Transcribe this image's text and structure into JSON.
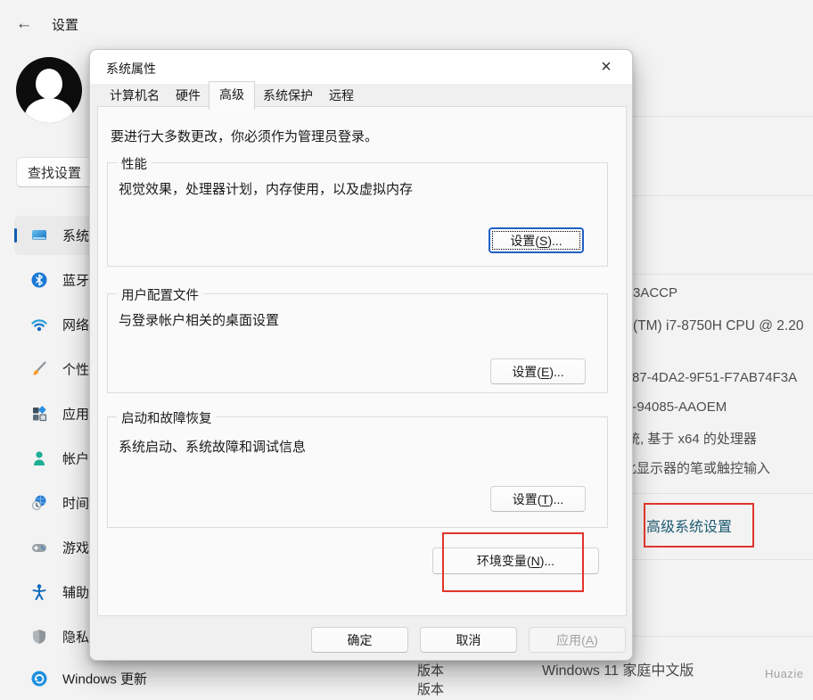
{
  "page": {
    "title": "设置",
    "back_icon": "←",
    "watermark": "Huazie"
  },
  "search": {
    "placeholder": "查找设置"
  },
  "sidebar": {
    "items": [
      {
        "label": "系统",
        "icon": "system-icon",
        "selected": true
      },
      {
        "label": "蓝牙和其他设备",
        "icon": "bluetooth-icon",
        "selected": false
      },
      {
        "label": "网络和 Internet",
        "icon": "network-icon",
        "selected": false
      },
      {
        "label": "个性化",
        "icon": "personalization-icon",
        "selected": false
      },
      {
        "label": "应用",
        "icon": "apps-icon",
        "selected": false
      },
      {
        "label": "帐户",
        "icon": "accounts-icon",
        "selected": false
      },
      {
        "label": "时间和语言",
        "icon": "time-language-icon",
        "selected": false
      },
      {
        "label": "游戏",
        "icon": "gaming-icon",
        "selected": false
      },
      {
        "label": "辅助功能",
        "icon": "accessibility-icon",
        "selected": false
      },
      {
        "label": "隐私和安全性",
        "icon": "privacy-icon",
        "selected": false
      },
      {
        "label": "Windows 更新",
        "icon": "windows-update-icon",
        "selected": false
      }
    ]
  },
  "dialog": {
    "title": "系统属性",
    "close_icon": "×",
    "tabs": [
      {
        "label": "计算机名"
      },
      {
        "label": "硬件"
      },
      {
        "label": "高级",
        "active": true
      },
      {
        "label": "系统保护"
      },
      {
        "label": "远程"
      }
    ],
    "admin_note": "要进行大多数更改，你必须作为管理员登录。",
    "groups": {
      "performance": {
        "legend": "性能",
        "desc": "视觉效果，处理器计划，内存使用，以及虚拟内存",
        "btn": {
          "pre": "设置(",
          "key": "S",
          "post": ")..."
        }
      },
      "user_profiles": {
        "legend": "用户配置文件",
        "desc": "与登录帐户相关的桌面设置",
        "btn": {
          "pre": "设置(",
          "key": "E",
          "post": ")..."
        }
      },
      "startup_recovery": {
        "legend": "启动和故障恢复",
        "desc": "系统启动、系统故障和调试信息",
        "btn": {
          "pre": "设置(",
          "key": "T",
          "post": ")..."
        }
      }
    },
    "env_button": {
      "pre": "环境变量(",
      "key": "N",
      "post": ")..."
    },
    "footer": {
      "ok": "确定",
      "cancel": "取消",
      "apply": {
        "pre": "应用(",
        "key": "A",
        "post": ")"
      }
    }
  },
  "about_panel": {
    "fragments": [
      "3ACCP",
      "(TM) i7-8750H CPU @ 2.20",
      "87-4DA2-9F51-F7AB74F3A",
      "0-94085-AAOEM",
      "统, 基于 x64 的处理器",
      "此显示器的笔或触控输入"
    ],
    "advanced_link": "高级系统设置",
    "version_label": "版本",
    "version_value": "Windows 11 家庭中文版",
    "version_label2": "版本"
  },
  "colors": {
    "accent": "#0f5cad",
    "annotation_red": "#e0352b",
    "link_teal": "#1d5a70",
    "page_bg": "#f3f3f3",
    "dialog_bg": "#f0f0f0"
  }
}
